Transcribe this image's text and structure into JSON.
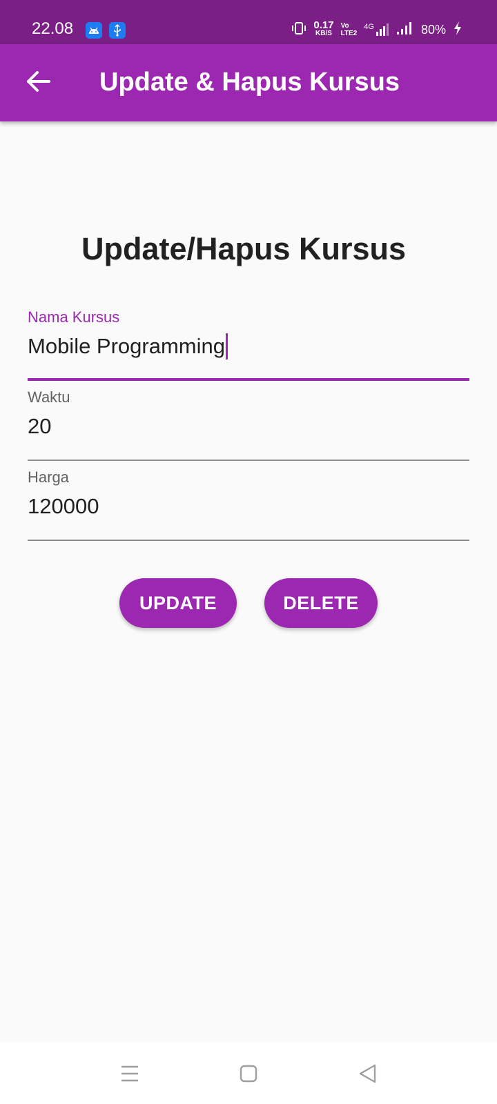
{
  "status_bar": {
    "time": "22.08",
    "net_speed_value": "0.17",
    "net_speed_unit": "KB/S",
    "volte_top": "Vo",
    "volte_bottom": "LTE2",
    "network_type": "4G",
    "battery": "80%"
  },
  "app_bar": {
    "title": "Update & Hapus Kursus"
  },
  "form": {
    "heading": "Update/Hapus Kursus",
    "fields": [
      {
        "label": "Nama Kursus",
        "value": "Mobile Programming",
        "focused": true
      },
      {
        "label": "Waktu",
        "value": "20",
        "focused": false
      },
      {
        "label": "Harga",
        "value": "120000",
        "focused": false
      }
    ],
    "update_label": "UPDATE",
    "delete_label": "DELETE"
  },
  "colors": {
    "primary": "#9c27b0",
    "primary_dark": "#7b1f86",
    "background": "#fafafa"
  },
  "icons": {
    "back": "back-arrow-icon",
    "menu": "recent-apps-icon",
    "home": "home-icon",
    "back_nav": "back-triangle-icon"
  }
}
